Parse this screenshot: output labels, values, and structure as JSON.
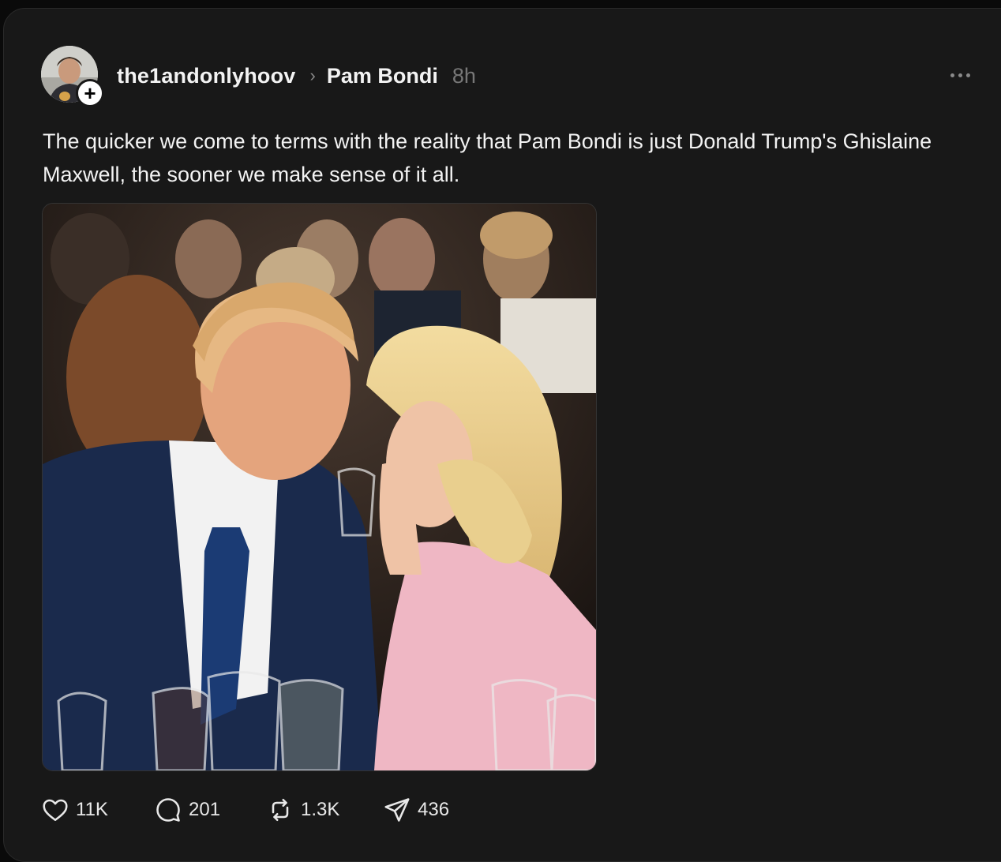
{
  "post": {
    "username": "the1andonlyhoov",
    "separator": "›",
    "topic": "Pam Bondi",
    "time": "8h",
    "follow_symbol": "+",
    "text": "The quicker we come to terms with the reality that Pam Bondi is just Donald Trump's Ghislaine Maxwell, the sooner we make sense of it all."
  },
  "actions": {
    "likes": "11K",
    "replies": "201",
    "reposts": "1.3K",
    "shares": "436"
  },
  "icons": {
    "like": "heart-icon",
    "reply": "comment-icon",
    "repost": "repost-icon",
    "share": "send-icon",
    "more": "more-icon"
  },
  "colors": {
    "background": "#0a0a0a",
    "card": "#181818",
    "text": "#f3f3f3",
    "muted": "#777777"
  }
}
